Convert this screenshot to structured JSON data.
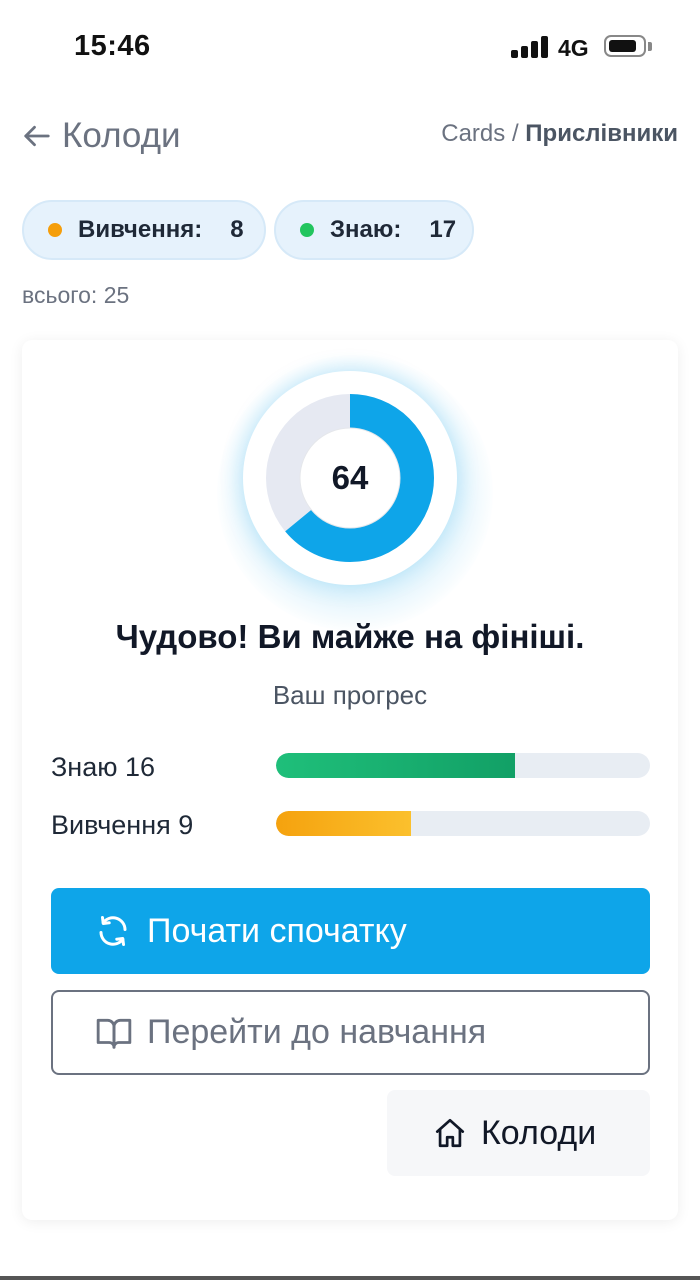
{
  "status_bar": {
    "time": "15:46",
    "network": "4G",
    "battery_level": 0.8
  },
  "header": {
    "back_label": "Колоди",
    "breadcrumb_root": "Cards",
    "breadcrumb_separator": " / ",
    "breadcrumb_current": "Прислівники"
  },
  "stats": {
    "learning_label": "Вивчення:",
    "learning_count": "8",
    "learning_color": "#f59e0b",
    "know_label": "Знаю:",
    "know_count": "17",
    "know_color": "#22c55e",
    "total_text": "всього: 25"
  },
  "progress": {
    "ring_value": "64",
    "ring_percent": 64,
    "ring_color": "#0ea5e9",
    "headline": "Чудово! Ви майже на фініші.",
    "subtitle": "Ваш прогрес",
    "bars": [
      {
        "label": "Знаю 16",
        "fraction": 0.64,
        "color": "green"
      },
      {
        "label": "Вивчення 9",
        "fraction": 0.36,
        "color": "orange"
      }
    ]
  },
  "actions": {
    "restart_label": "Почати спочатку",
    "study_label": "Перейти до навчання",
    "decks_label": "Колоди"
  }
}
